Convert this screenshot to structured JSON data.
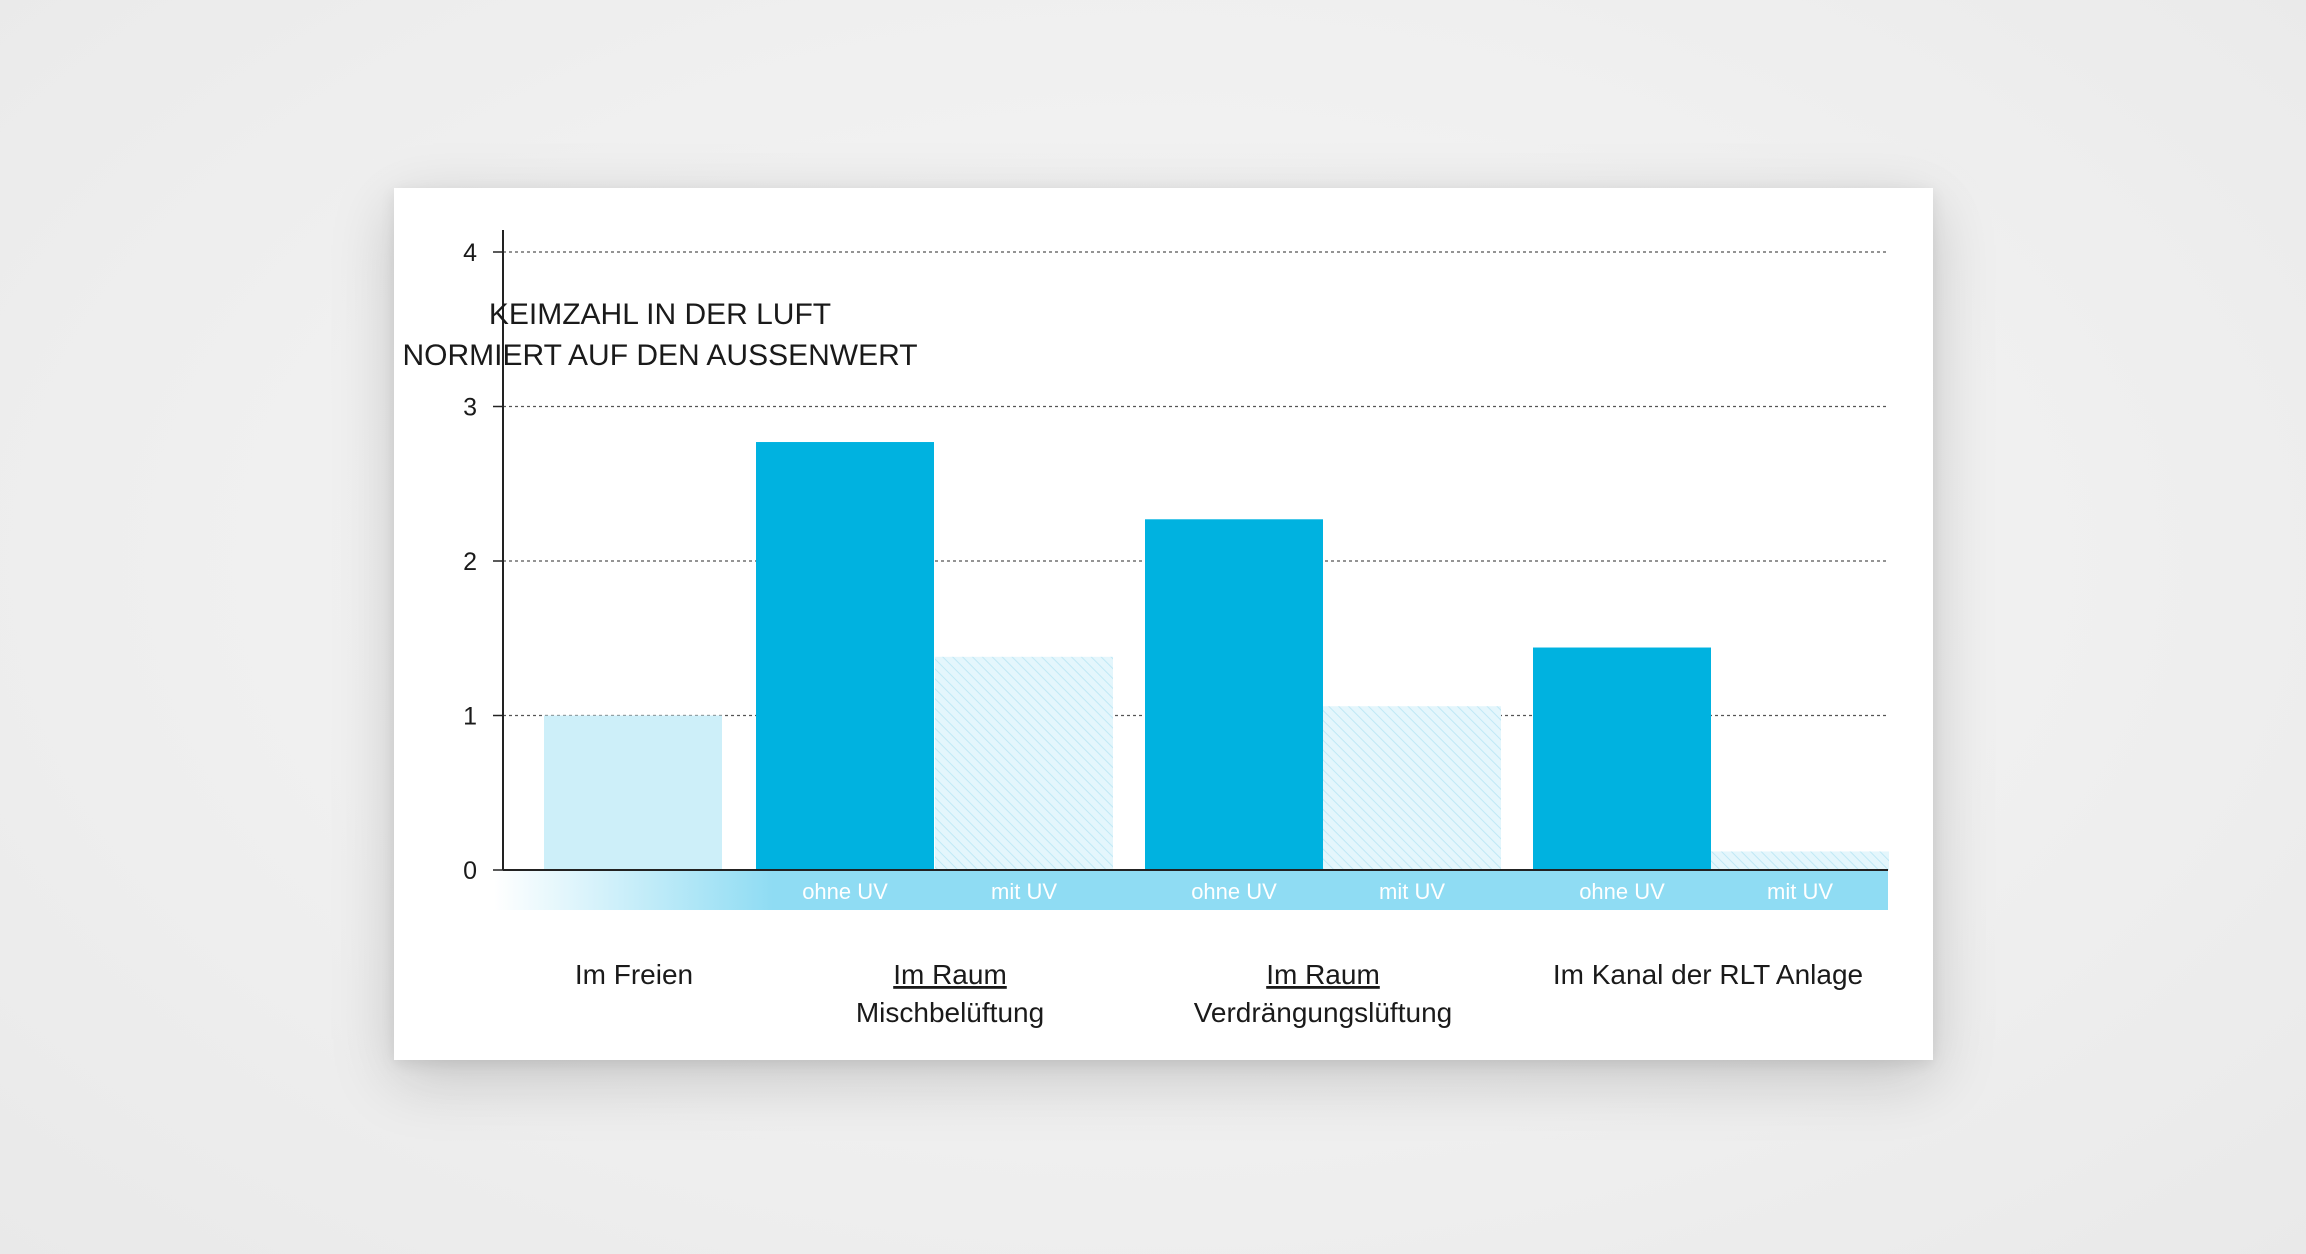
{
  "chart_data": {
    "type": "bar",
    "title_lines": [
      "KEIMZAHL IN DER LUFT",
      "NORMIERT AUF DEN AUSSENWERT"
    ],
    "ylim": [
      0,
      4
    ],
    "yticks": [
      "0",
      "1",
      "2",
      "3",
      "4"
    ],
    "grid": true,
    "groups": [
      {
        "name_lines": [
          "Im Freien"
        ],
        "underline_first": false
      },
      {
        "name_lines": [
          "Im Raum",
          "Mischbelüftung"
        ],
        "underline_first": true
      },
      {
        "name_lines": [
          "Im Raum",
          "Verdrängungslüftung"
        ],
        "underline_first": true
      },
      {
        "name_lines": [
          "Im Kanal der RLT Anlage"
        ],
        "underline_first": false
      }
    ],
    "bars": [
      {
        "group": 0,
        "label": "",
        "value": 1.0,
        "style": "light"
      },
      {
        "group": 1,
        "label": "ohne UV",
        "value": 2.77,
        "style": "solid"
      },
      {
        "group": 1,
        "label": "mit UV",
        "value": 1.38,
        "style": "hatched"
      },
      {
        "group": 2,
        "label": "ohne UV",
        "value": 2.27,
        "style": "solid"
      },
      {
        "group": 2,
        "label": "mit UV",
        "value": 1.06,
        "style": "hatched"
      },
      {
        "group": 3,
        "label": "ohne UV",
        "value": 1.44,
        "style": "solid"
      },
      {
        "group": 3,
        "label": "mit UV",
        "value": 0.12,
        "style": "hatched"
      }
    ],
    "colors": {
      "solid": "#00b2e0",
      "light": "#cdeff9",
      "hatched_base": "#e4f6fc",
      "hatched_line": "#bfe8f5",
      "band": "#8fdcf3",
      "axis": "#222222",
      "grid": "#555555"
    }
  }
}
